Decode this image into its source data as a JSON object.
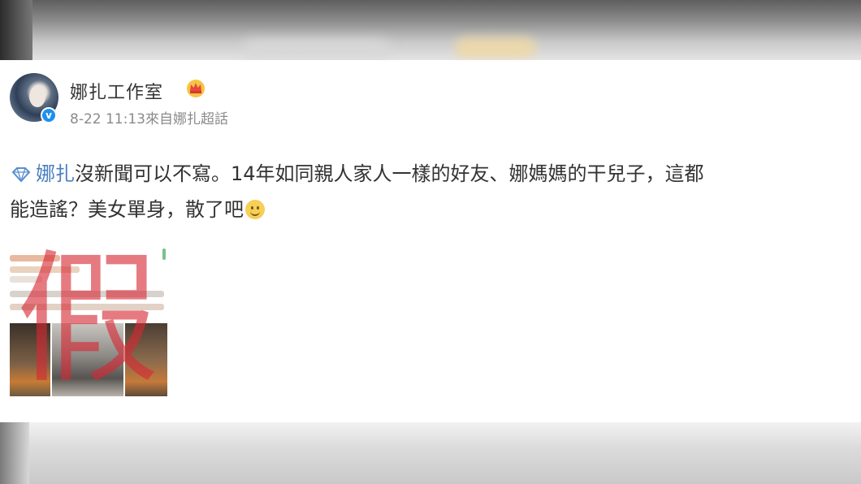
{
  "account": {
    "name": "娜扎工作室",
    "badge_icon": "crown-icon",
    "verified_icon": "verified-icon",
    "verified_mark": "v"
  },
  "post": {
    "time": "8-22 11:13",
    "source": "來自娜扎超話",
    "hashtag": "娜扎",
    "text_line1": "沒新聞可以不寫。14年如同親人家人一樣的好友、娜媽媽的干兒子，這都",
    "text_line2": "能造謠？美女單身，散了吧",
    "emoji": "smile-icon"
  },
  "attachment": {
    "stamp_text": "假"
  },
  "colors": {
    "link": "#4a7fc1",
    "text": "#333333",
    "meta": "#8a8a8a",
    "stamp": "#d62834"
  }
}
